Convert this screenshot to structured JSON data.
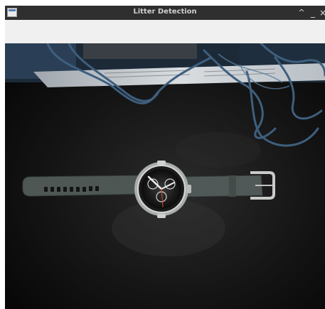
{
  "window": {
    "title": "Litter Detection",
    "controls": {
      "maximize": "^",
      "minimize": "_",
      "close": "×"
    }
  },
  "camera_feed": {
    "subject": "wristwatch on dark desk"
  },
  "colors": {
    "titlebar": "#2f2f2f",
    "window_bg": "#f0f0f0",
    "feed_bg": "#0d0d0d"
  }
}
